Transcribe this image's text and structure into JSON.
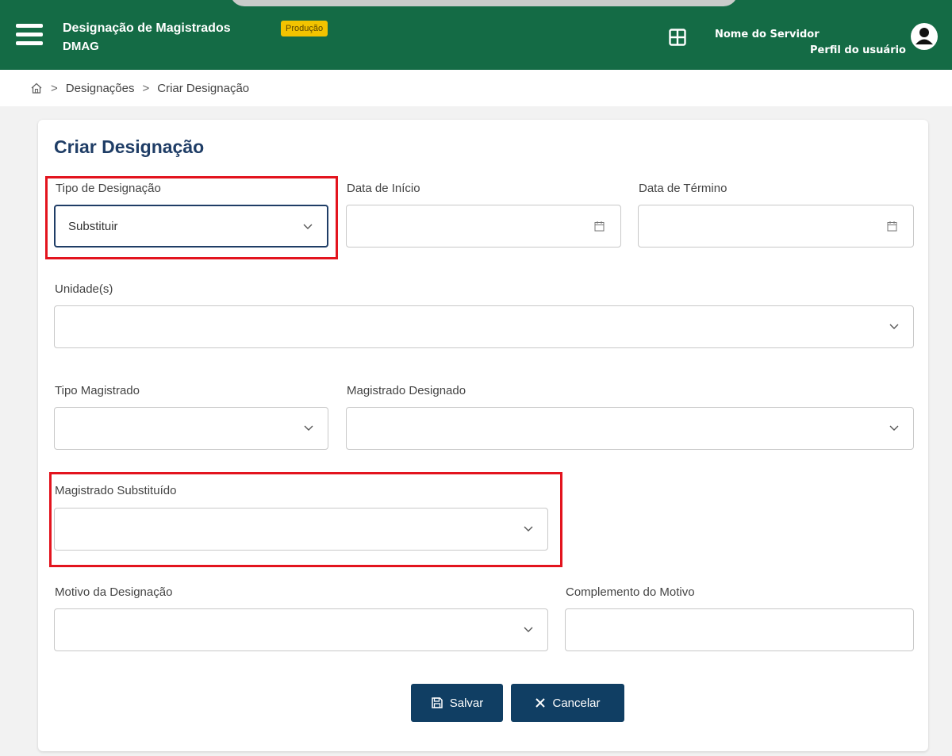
{
  "header": {
    "app_title": "Designação de Magistrados",
    "app_short": "DMAG",
    "env_badge": "Produção",
    "user_name": "Nome do Servidor",
    "user_profile": "Perfil do usuário"
  },
  "breadcrumb": {
    "items": [
      "Designações",
      "Criar Designação"
    ]
  },
  "form": {
    "title": "Criar Designação",
    "tipo_designacao": {
      "label": "Tipo de Designação",
      "value": "Substituir"
    },
    "data_inicio": {
      "label": "Data de Início",
      "value": ""
    },
    "data_termino": {
      "label": "Data de Término",
      "value": ""
    },
    "unidades": {
      "label": "Unidade(s)",
      "value": ""
    },
    "tipo_magistrado": {
      "label": "Tipo Magistrado",
      "value": ""
    },
    "magistrado_designado": {
      "label": "Magistrado Designado",
      "value": ""
    },
    "magistrado_substituido": {
      "label": "Magistrado Substituído",
      "value": ""
    },
    "motivo": {
      "label": "Motivo da Designação",
      "value": ""
    },
    "complemento": {
      "label": "Complemento do Motivo",
      "value": ""
    }
  },
  "actions": {
    "save_label": "Salvar",
    "cancel_label": "Cancelar"
  },
  "colors": {
    "header_green": "#146b45",
    "accent_navy": "#103e63",
    "highlight_red": "#e3141e",
    "badge_yellow": "#f2c300"
  }
}
